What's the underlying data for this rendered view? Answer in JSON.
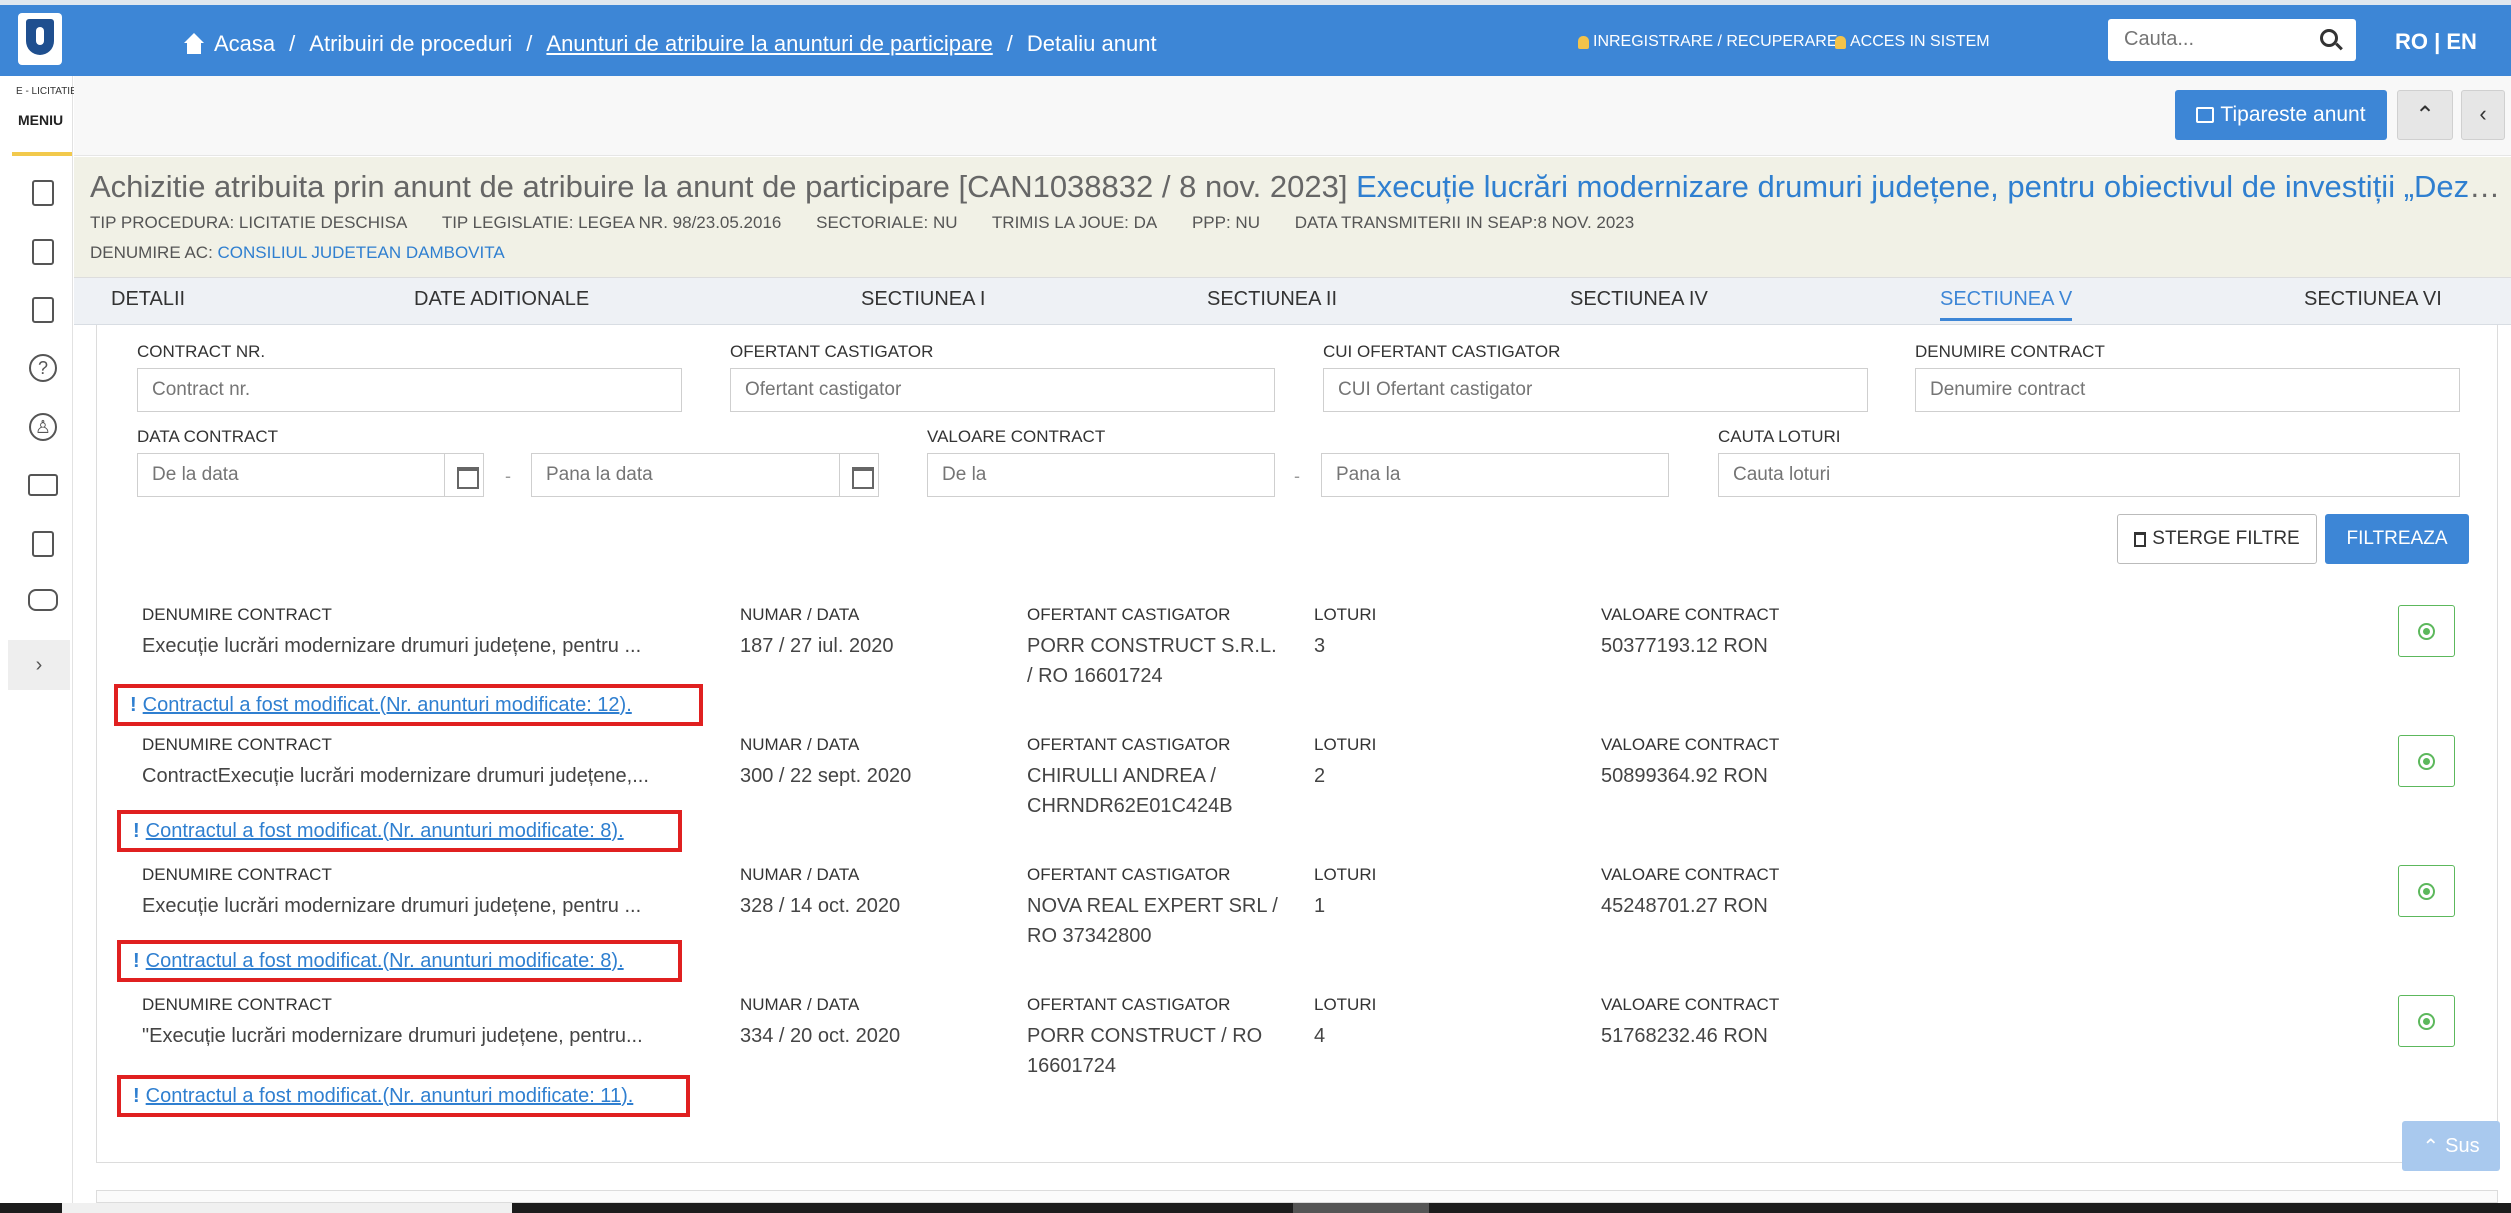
{
  "nav": {
    "crumbs": [
      "Acasa",
      "Atribuiri de proceduri",
      "Anunturi de atribuire la anunturi de participare",
      "Detaliu anunt"
    ],
    "register": "INREGISTRARE / RECUPERARE",
    "login": "ACCES IN SISTEM",
    "search_placeholder": "Cauta...",
    "lang": "RO | EN"
  },
  "sidebar": {
    "small": "E - LICITATIE",
    "menu": "MENIU",
    "icons": [
      "document-icon",
      "list-arrow-icon",
      "clipboard-check-icon",
      "help-icon",
      "user-tree-icon",
      "id-card-icon",
      "archive-icon",
      "chat-icon"
    ],
    "expand": "›"
  },
  "toolbar": {
    "print": "Tipareste anunt",
    "up": "⌃",
    "left": "‹"
  },
  "notice": {
    "title_prefix": "Achizitie atribuita prin anunt de atribuire la anunt de participare [CAN1038832 / 8 nov. 2023]",
    "title_link": "Execuție lucrări modernizare drumuri județene, pentru obiectivul de investiții „Dezvoltarea infrastructurii de transport județean...”",
    "meta": [
      "TIP PROCEDURA: LICITATIE DESCHISA",
      "TIP LEGISLATIE: LEGEA NR. 98/23.05.2016",
      "SECTORIALE: NU",
      "TRIMIS LA JOUE: DA",
      "PPP: NU",
      "DATA TRANSMITERII IN SEAP:8 NOV. 2023"
    ],
    "ac_label": "DENUMIRE AC:",
    "ac_value": "CONSILIUL JUDETEAN DAMBOVITA"
  },
  "tabs": [
    "DETALII",
    "DATE ADITIONALE",
    "SECTIUNEA I",
    "SECTIUNEA II",
    "SECTIUNEA IV",
    "SECTIUNEA V",
    "SECTIUNEA VI"
  ],
  "filters": {
    "contract_nr": {
      "label": "CONTRACT NR.",
      "placeholder": "Contract nr."
    },
    "ofertant": {
      "label": "OFERTANT CASTIGATOR",
      "placeholder": "Ofertant castigator"
    },
    "cui": {
      "label": "CUI OFERTANT CASTIGATOR",
      "placeholder": "CUI Ofertant castigator"
    },
    "denumire": {
      "label": "DENUMIRE CONTRACT",
      "placeholder": "Denumire contract"
    },
    "data": {
      "label": "DATA CONTRACT",
      "from": "De la data",
      "to": "Pana la data"
    },
    "valoare": {
      "label": "VALOARE CONTRACT",
      "from": "De la",
      "to": "Pana la"
    },
    "loturi": {
      "label": "CAUTA LOTURI",
      "placeholder": "Cauta loturi"
    },
    "dash": "-",
    "clear": "STERGE FILTRE",
    "apply": "FILTREAZA"
  },
  "columns": {
    "denumire": "DENUMIRE CONTRACT",
    "numar": "NUMAR / DATA",
    "ofertant": "OFERTANT CASTIGATOR",
    "loturi": "LOTURI",
    "valoare": "VALOARE CONTRACT"
  },
  "contracts": [
    {
      "denumire": "Execuție lucrări modernizare drumuri județene, pentru ...",
      "numar": "187 / 27 iul. 2020",
      "ofertant": "PORR CONSTRUCT S.R.L. / RO 16601724",
      "loturi": "3",
      "valoare": "50377193.12 RON",
      "mod": "Contractul a fost modificat.(Nr. anunturi modificate: 12)."
    },
    {
      "denumire": "ContractExecuție lucrări modernizare drumuri județene,...",
      "numar": "300 / 22 sept. 2020",
      "ofertant": "CHIRULLI ANDREA / CHRNDR62E01C424B",
      "loturi": "2",
      "valoare": "50899364.92 RON",
      "mod": "Contractul a fost modificat.(Nr. anunturi modificate: 8)."
    },
    {
      "denumire": "Execuție lucrări modernizare drumuri județene, pentru ...",
      "numar": "328 / 14 oct. 2020",
      "ofertant": "NOVA REAL EXPERT SRL / RO 37342800",
      "loturi": "1",
      "valoare": "45248701.27 RON",
      "mod": "Contractul a fost modificat.(Nr. anunturi modificate: 8)."
    },
    {
      "denumire": "\"Execuție lucrări modernizare drumuri județene, pentru...",
      "numar": "334 / 20 oct. 2020",
      "ofertant": "PORR CONSTRUCT / RO 16601724",
      "loturi": "4",
      "valoare": "51768232.46 RON",
      "mod": "Contractul a fost modificat.(Nr. anunturi modificate: 11)."
    }
  ],
  "scroll_top": "Sus"
}
